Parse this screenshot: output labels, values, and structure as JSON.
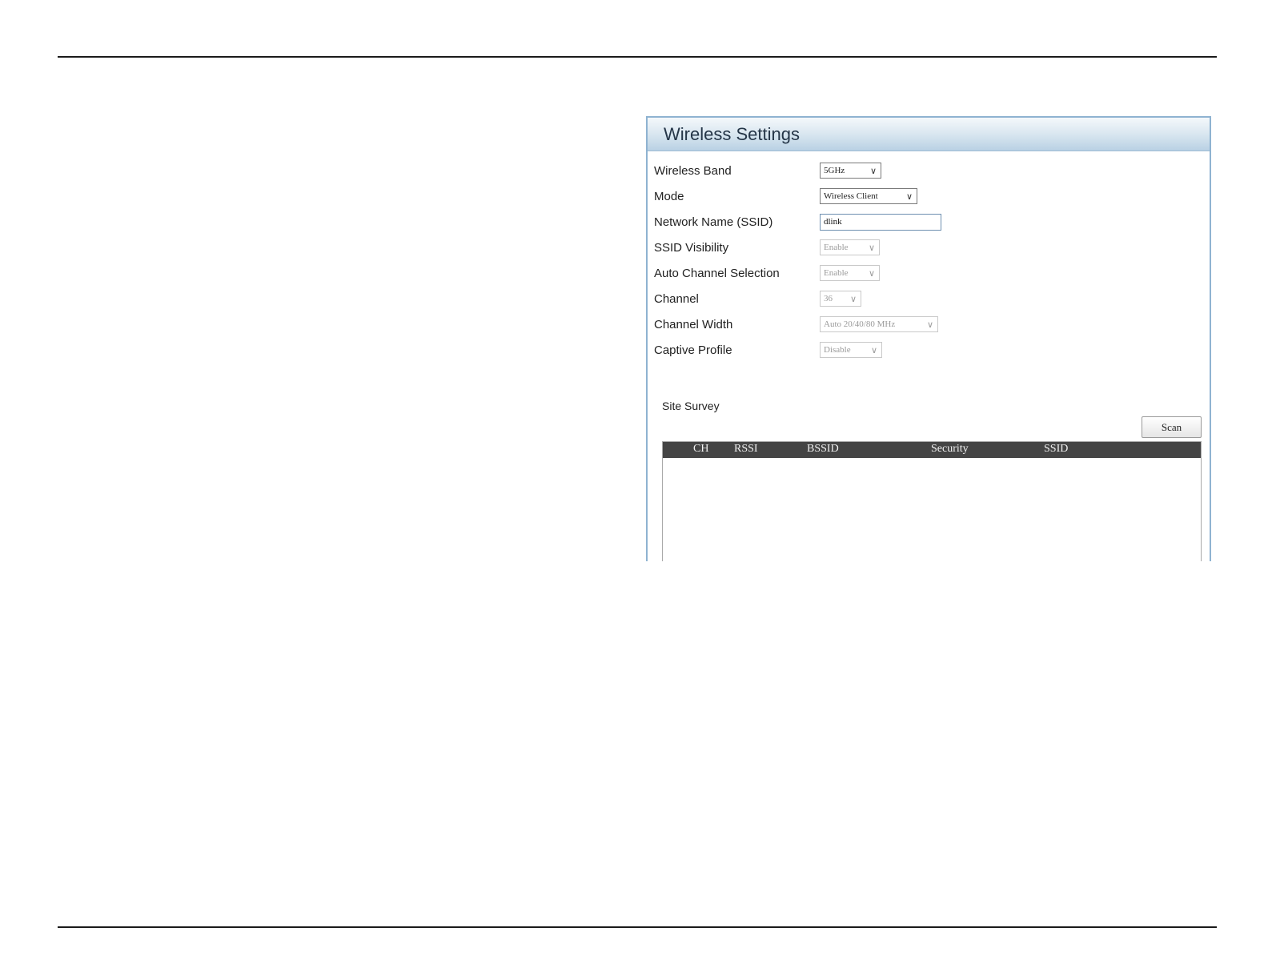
{
  "panel": {
    "title": "Wireless Settings"
  },
  "fields": [
    {
      "label": "Wireless Band",
      "type": "select",
      "value": "5GHz",
      "disabled": false
    },
    {
      "label": "Mode",
      "type": "select",
      "value": "Wireless Client",
      "disabled": false
    },
    {
      "label": "Network Name (SSID)",
      "type": "text",
      "value": "dlink",
      "disabled": false
    },
    {
      "label": "SSID Visibility",
      "type": "select",
      "value": "Enable",
      "disabled": true
    },
    {
      "label": "Auto Channel Selection",
      "type": "select",
      "value": "Enable",
      "disabled": true
    },
    {
      "label": "Channel",
      "type": "select",
      "value": "36",
      "disabled": true
    },
    {
      "label": "Channel Width",
      "type": "select",
      "value": "Auto 20/40/80 MHz",
      "disabled": true
    },
    {
      "label": "Captive Profile",
      "type": "select",
      "value": "Disable",
      "disabled": true
    }
  ],
  "site_survey": {
    "label": "Site Survey",
    "scan_label": "Scan",
    "columns": [
      "CH",
      "RSSI",
      "BSSID",
      "Security",
      "SSID"
    ]
  },
  "icons": {
    "dropdown": "chevron-down-icon"
  },
  "colors": {
    "header_gradient_end": "#b9d1e4",
    "panel_border": "#8fb3d1",
    "table_header": "#444444"
  }
}
